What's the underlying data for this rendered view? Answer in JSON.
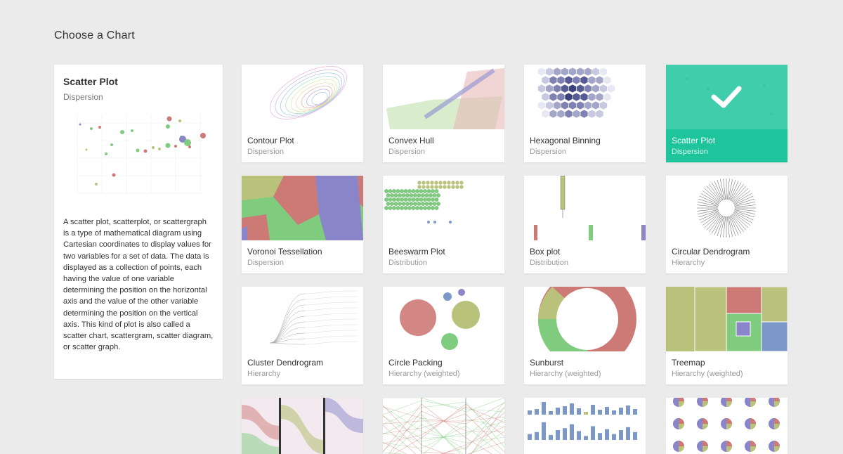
{
  "page": {
    "title": "Choose a Chart"
  },
  "selected": {
    "title": "Scatter Plot",
    "category": "Dispersion",
    "description": "A scatter plot, scatterplot, or scattergraph is a type of mathematical diagram using Cartesian coordinates to display values for two variables for a set of data. The data is displayed as a collection of points, each having the value of one variable determining the position on the horizontal axis and the value of the other variable determining the position on the vertical axis. This kind of plot is also called a scatter chart, scattergram, scatter diagram, or scatter graph."
  },
  "charts": [
    {
      "title": "Contour Plot",
      "category": "Dispersion",
      "thumb": "contour"
    },
    {
      "title": "Convex Hull",
      "category": "Dispersion",
      "thumb": "hull"
    },
    {
      "title": "Hexagonal Binning",
      "category": "Dispersion",
      "thumb": "hex"
    },
    {
      "title": "Scatter Plot",
      "category": "Dispersion",
      "thumb": "scatter",
      "selected": true
    },
    {
      "title": "Voronoi Tessellation",
      "category": "Dispersion",
      "thumb": "voronoi"
    },
    {
      "title": "Beeswarm Plot",
      "category": "Distribution",
      "thumb": "beeswarm"
    },
    {
      "title": "Box plot",
      "category": "Distribution",
      "thumb": "boxplot"
    },
    {
      "title": "Circular Dendrogram",
      "category": "Hierarchy",
      "thumb": "circdendro"
    },
    {
      "title": "Cluster Dendrogram",
      "category": "Hierarchy",
      "thumb": "dendro"
    },
    {
      "title": "Circle Packing",
      "category": "Hierarchy (weighted)",
      "thumb": "packing"
    },
    {
      "title": "Sunburst",
      "category": "Hierarchy (weighted)",
      "thumb": "sunburst"
    },
    {
      "title": "Treemap",
      "category": "Hierarchy (weighted)",
      "thumb": "treemap"
    },
    {
      "title": "",
      "category": "",
      "thumb": "alluvial"
    },
    {
      "title": "",
      "category": "",
      "thumb": "parallel"
    },
    {
      "title": "",
      "category": "",
      "thumb": "barsmall"
    },
    {
      "title": "",
      "category": "",
      "thumb": "pies"
    }
  ],
  "colors": {
    "accent": "#1ec49c",
    "red": "#cd7a77",
    "green": "#7fcc7f",
    "olive": "#b9c27a",
    "purple": "#8a85c9",
    "blue": "#7b98c9"
  }
}
